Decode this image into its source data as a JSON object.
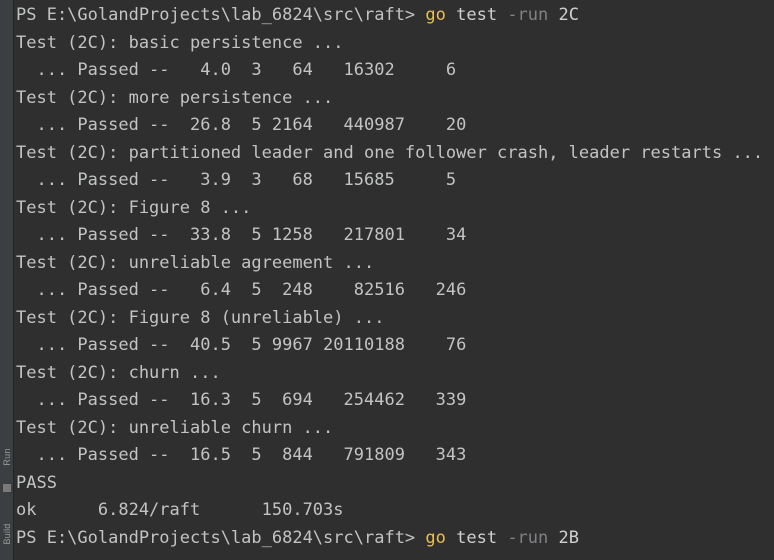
{
  "window": {
    "background_color": "#2f2f2f",
    "gutter_color": "#3c3f41",
    "default_text_color": "#c2c3c4",
    "dim_text_color": "#7f8184",
    "command_text_color": "#e8bf51"
  },
  "gutter": {
    "run_label": "Run",
    "build_label": "Build",
    "icon_name": "tool-window-icon"
  },
  "terminal": {
    "clipped_top_line": " ",
    "lines": [
      {
        "name": "prompt-line-1",
        "segments": [
          {
            "text": "PS E:\\GolandProjects\\lab_6824\\src\\raft> ",
            "style": "t-default"
          },
          {
            "text": "go",
            "style": "t-cmd"
          },
          {
            "text": " test ",
            "style": "t-bright"
          },
          {
            "text": "-run",
            "style": "t-dim"
          },
          {
            "text": " 2C",
            "style": "t-bright"
          }
        ]
      },
      {
        "name": "test-header-line",
        "segments": [
          {
            "text": "Test (2C): basic persistence ...",
            "style": "t-default"
          }
        ]
      },
      {
        "name": "test-result-line",
        "segments": [
          {
            "text": "  ... Passed --   4.0  3   64   16302     6",
            "style": "t-default"
          }
        ]
      },
      {
        "name": "test-header-line",
        "segments": [
          {
            "text": "Test (2C): more persistence ...",
            "style": "t-default"
          }
        ]
      },
      {
        "name": "test-result-line",
        "segments": [
          {
            "text": "  ... Passed --  26.8  5 2164   440987    20",
            "style": "t-default"
          }
        ]
      },
      {
        "name": "test-header-line",
        "segments": [
          {
            "text": "Test (2C): partitioned leader and one follower crash, leader restarts ...",
            "style": "t-default"
          }
        ]
      },
      {
        "name": "test-result-line",
        "segments": [
          {
            "text": "  ... Passed --   3.9  3   68   15685     5",
            "style": "t-default"
          }
        ]
      },
      {
        "name": "test-header-line",
        "segments": [
          {
            "text": "Test (2C): Figure 8 ...",
            "style": "t-default"
          }
        ]
      },
      {
        "name": "test-result-line",
        "segments": [
          {
            "text": "  ... Passed --  33.8  5 1258   217801    34",
            "style": "t-default"
          }
        ]
      },
      {
        "name": "test-header-line",
        "segments": [
          {
            "text": "Test (2C): unreliable agreement ...",
            "style": "t-default"
          }
        ]
      },
      {
        "name": "test-result-line",
        "segments": [
          {
            "text": "  ... Passed --   6.4  5  248    82516   246",
            "style": "t-default"
          }
        ]
      },
      {
        "name": "test-header-line",
        "segments": [
          {
            "text": "Test (2C): Figure 8 (unreliable) ...",
            "style": "t-default"
          }
        ]
      },
      {
        "name": "test-result-line",
        "segments": [
          {
            "text": "  ... Passed --  40.5  5 9967 20110188    76",
            "style": "t-default"
          }
        ]
      },
      {
        "name": "test-header-line",
        "segments": [
          {
            "text": "Test (2C): churn ...",
            "style": "t-default"
          }
        ]
      },
      {
        "name": "test-result-line",
        "segments": [
          {
            "text": "  ... Passed --  16.3  5  694   254462   339",
            "style": "t-default"
          }
        ]
      },
      {
        "name": "test-header-line",
        "segments": [
          {
            "text": "Test (2C): unreliable churn ...",
            "style": "t-default"
          }
        ]
      },
      {
        "name": "test-result-line",
        "segments": [
          {
            "text": "  ... Passed --  16.5  5  844   791809   343",
            "style": "t-default"
          }
        ]
      },
      {
        "name": "pass-status-line",
        "segments": [
          {
            "text": "PASS",
            "style": "t-default"
          }
        ]
      },
      {
        "name": "package-summary-line",
        "segments": [
          {
            "text": "ok      6.824/raft      150.703s",
            "style": "t-default"
          }
        ]
      },
      {
        "name": "prompt-line-2",
        "segments": [
          {
            "text": "PS E:\\GolandProjects\\lab_6824\\src\\raft> ",
            "style": "t-default"
          },
          {
            "text": "go",
            "style": "t-cmd"
          },
          {
            "text": " test ",
            "style": "t-bright"
          },
          {
            "text": "-run",
            "style": "t-dim"
          },
          {
            "text": " 2B",
            "style": "t-bright"
          }
        ]
      }
    ]
  }
}
